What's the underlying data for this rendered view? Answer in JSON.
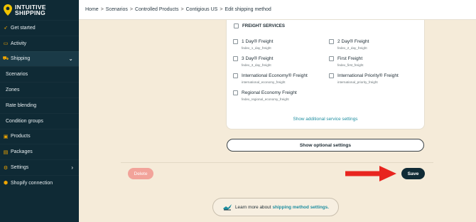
{
  "brand": {
    "line1": "INTUITIVE",
    "line2": "SHIPPING"
  },
  "breadcrumb": [
    "Home",
    "Scenarios",
    "Controlled Products",
    "Contigious US",
    "Edit shipping method"
  ],
  "breadcrumb_sep": ">",
  "sidebar": {
    "items": [
      {
        "label": "Get started",
        "icon": "rocket-icon"
      },
      {
        "label": "Activity",
        "icon": "activity-icon"
      },
      {
        "label": "Shipping",
        "icon": "truck-icon",
        "chevron": "⌄"
      },
      {
        "label": "Scenarios"
      },
      {
        "label": "Zones"
      },
      {
        "label": "Rate blending"
      },
      {
        "label": "Condition groups"
      },
      {
        "label": "Products",
        "icon": "box-icon"
      },
      {
        "label": "Packages",
        "icon": "package-icon"
      },
      {
        "label": "Settings",
        "icon": "gear-icon",
        "chevron": "›"
      },
      {
        "label": "Shopify connection",
        "icon": "shopify-icon"
      }
    ]
  },
  "freight": {
    "title": "FREIGHT SERVICES",
    "services": [
      {
        "name": "1 Day® Freight",
        "code": "fedex_1_day_freight"
      },
      {
        "name": "2 Day® Freight",
        "code": "fedex_2_day_freight"
      },
      {
        "name": "3 Day® Freight",
        "code": "fedex_3_day_freight"
      },
      {
        "name": "First Freight",
        "code": "fedex_first_freight"
      },
      {
        "name": "International Economy® Freight",
        "code": "international_economy_freight"
      },
      {
        "name": "International Priority® Freight",
        "code": "international_priority_freight"
      },
      {
        "name": "Regional Economy Freight",
        "code": "fedex_regional_economy_freight"
      }
    ],
    "show_additional": "Show additional service settings"
  },
  "buttons": {
    "optional": "Show optional settings",
    "delete": "Delete",
    "save": "Save"
  },
  "learn": {
    "text": "Learn more about",
    "link": "shipping method settings."
  },
  "colors": {
    "sidebar_bg": "#0f2a35",
    "accent": "#1f8ea0",
    "arrow": "#e8251f",
    "delete": "#f2a39a",
    "save": "#102b36"
  }
}
